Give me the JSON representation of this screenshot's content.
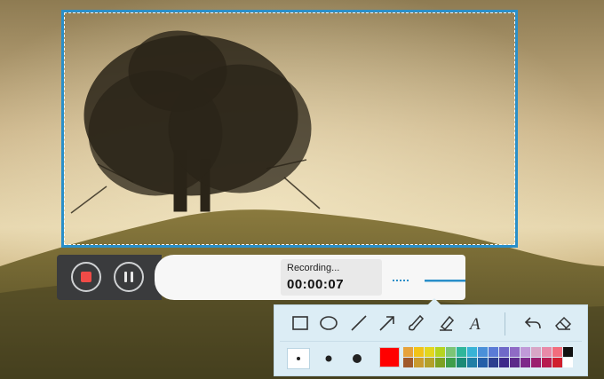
{
  "recording": {
    "status": "Recording...",
    "timer": "00:00:07"
  },
  "icons": {
    "stop": "stop-icon",
    "pause": "pause-icon",
    "volume": "volume-slider",
    "webcam": "webcam-icon",
    "pen": "pencil-icon"
  },
  "annotation": {
    "tools": [
      {
        "name": "rectangle-tool"
      },
      {
        "name": "ellipse-tool"
      },
      {
        "name": "line-tool"
      },
      {
        "name": "arrow-tool"
      },
      {
        "name": "brush-tool"
      },
      {
        "name": "highlighter-tool"
      },
      {
        "name": "text-tool",
        "label": "A"
      },
      {
        "name": "undo-tool"
      },
      {
        "name": "eraser-tool"
      }
    ],
    "sizes": [
      "small",
      "medium",
      "large"
    ],
    "selected_size": "small",
    "current_color": "#ff0000",
    "palette": [
      "#e6a23c",
      "#f2c318",
      "#e3d61e",
      "#b5d420",
      "#7cc576",
      "#2fb69b",
      "#38b3d6",
      "#4a90d9",
      "#5a7bd6",
      "#6f69c8",
      "#8f6bc5",
      "#c09ad8",
      "#d8a6c6",
      "#e88aa8",
      "#f26d7d",
      "#111111",
      "#a05a2c",
      "#c99a2e",
      "#b3a02a",
      "#7da123",
      "#3f9e4b",
      "#1b8a76",
      "#1f7fa6",
      "#245fa8",
      "#2c3f8f",
      "#3d2a8a",
      "#5c2a8a",
      "#7e2a8a",
      "#9b1f6e",
      "#b71c50",
      "#d01f2e",
      "#ffffff"
    ]
  }
}
